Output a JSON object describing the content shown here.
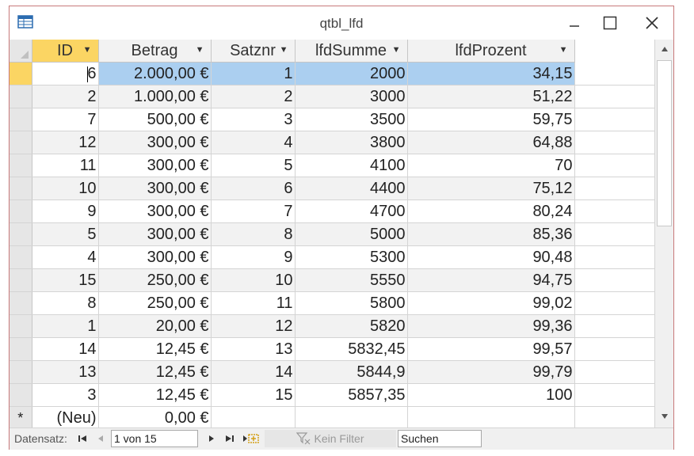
{
  "window": {
    "title": "qtbl_lfd",
    "minimize_icon": "minimize-icon",
    "maximize_icon": "maximize-icon",
    "close_icon": "close-icon"
  },
  "colors": {
    "selected_header": "#fbd563",
    "selected_row": "#abcff0",
    "window_border": "#c8797a"
  },
  "table": {
    "columns": [
      "ID",
      "Betrag",
      "Satznr",
      "lfdSumme",
      "lfdProzent"
    ],
    "rows": [
      [
        "6",
        "2.000,00 €",
        "1",
        "2000",
        "34,15"
      ],
      [
        "2",
        "1.000,00 €",
        "2",
        "3000",
        "51,22"
      ],
      [
        "7",
        "500,00 €",
        "3",
        "3500",
        "59,75"
      ],
      [
        "12",
        "300,00 €",
        "4",
        "3800",
        "64,88"
      ],
      [
        "11",
        "300,00 €",
        "5",
        "4100",
        "70"
      ],
      [
        "10",
        "300,00 €",
        "6",
        "4400",
        "75,12"
      ],
      [
        "9",
        "300,00 €",
        "7",
        "4700",
        "80,24"
      ],
      [
        "5",
        "300,00 €",
        "8",
        "5000",
        "85,36"
      ],
      [
        "4",
        "300,00 €",
        "9",
        "5300",
        "90,48"
      ],
      [
        "15",
        "250,00 €",
        "10",
        "5550",
        "94,75"
      ],
      [
        "8",
        "250,00 €",
        "11",
        "5800",
        "99,02"
      ],
      [
        "1",
        "20,00 €",
        "12",
        "5820",
        "99,36"
      ],
      [
        "14",
        "12,45 €",
        "13",
        "5832,45",
        "99,57"
      ],
      [
        "13",
        "12,45 €",
        "14",
        "5844,9",
        "99,79"
      ],
      [
        "3",
        "12,45 €",
        "15",
        "5857,35",
        "100"
      ]
    ],
    "new_row": {
      "marker": "*",
      "id": "(Neu)",
      "betrag": "0,00 €"
    }
  },
  "navigation": {
    "label": "Datensatz:",
    "record_position": "1 von 15",
    "filter_label": "Kein Filter",
    "search_placeholder": "Suchen"
  }
}
